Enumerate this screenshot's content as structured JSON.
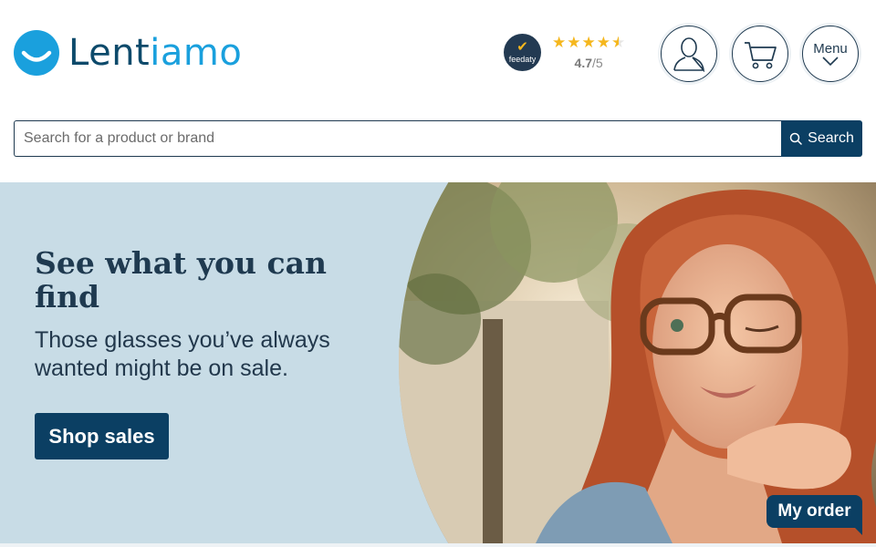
{
  "brand": {
    "name_part1": "Lent",
    "name_part2": "iamo",
    "primary_color": "#0d4a6b",
    "accent_color": "#1aa0dd"
  },
  "rating": {
    "provider": "feedaty",
    "stars_value": 4.7,
    "score": "4.7",
    "out_of": "/5",
    "star_color": "#f5b71d"
  },
  "header_buttons": {
    "account_icon": "user-icon",
    "cart_icon": "cart-icon",
    "menu_label": "Menu",
    "menu_icon": "chevron-down-icon"
  },
  "search": {
    "placeholder": "Search for a product or brand",
    "value": "",
    "button_label": "Search",
    "button_icon": "search-icon"
  },
  "hero": {
    "title": "See what you can find",
    "subtitle": "Those glasses you’ve always wanted might be on sale.",
    "cta_label": "Shop sales",
    "background_color": "#c8dce6"
  },
  "floating": {
    "order_label": "My order"
  }
}
